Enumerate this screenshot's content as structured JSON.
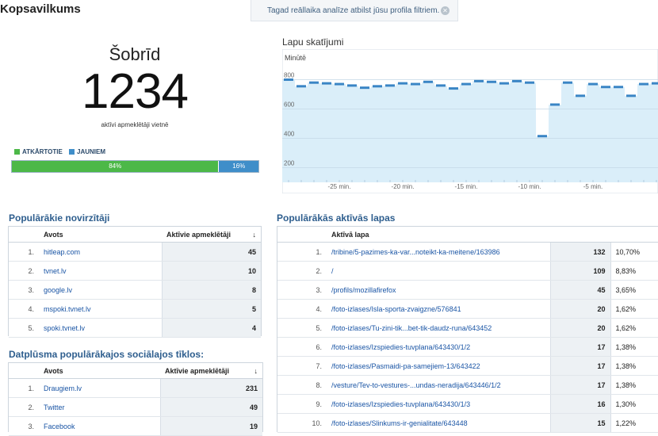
{
  "page_title": "Kopsavilkums",
  "notice": "Tagad reāllaika analīze atbilst jūsu profila filtriem.",
  "now": {
    "label": "Šobrīd",
    "count": "1234",
    "caption": "aktīvi apmeklētāji vietnē"
  },
  "visitor_split": {
    "returning_label": "ATKĀRTOTIE",
    "new_label": "JAUNIEM",
    "returning_pct": "84%",
    "new_pct": "16%",
    "returning_fraction": 0.84,
    "returning_color": "#4cb848",
    "new_color": "#3f8ec9"
  },
  "chart_data": {
    "type": "line",
    "title": "Lapu skatījumi",
    "ylabel": "Minūtē",
    "x_ticks": [
      "-25 min.",
      "-20 min.",
      "-15 min.",
      "-10 min.",
      "-5 min."
    ],
    "y_ticks": [
      "800",
      "600",
      "400",
      "200"
    ],
    "ylim": [
      100,
      900
    ],
    "x_range": [
      -29,
      0
    ],
    "x": [
      -29,
      -28,
      -27,
      -26,
      -25,
      -24,
      -23,
      -22,
      -21,
      -20,
      -19,
      -18,
      -17,
      -16,
      -15,
      -14,
      -13,
      -12,
      -11,
      -10,
      -9,
      -8,
      -7,
      -6,
      -5,
      -4,
      -3,
      -2,
      -1,
      0
    ],
    "values": [
      800,
      755,
      780,
      775,
      770,
      760,
      745,
      755,
      760,
      775,
      770,
      785,
      760,
      740,
      770,
      790,
      785,
      775,
      790,
      780,
      415,
      630,
      780,
      690,
      770,
      750,
      750,
      690,
      770,
      775
    ],
    "line_color": "#3a85c5",
    "fill_color": "#daeef9"
  },
  "referrers": {
    "title": "Populārākie novirzītāji",
    "col_source": "Avots",
    "col_active": "Aktīvie apmeklētāji",
    "sort_icon": "↓",
    "rows": [
      {
        "n": "1.",
        "name": "hitleap.com",
        "value": "45"
      },
      {
        "n": "2.",
        "name": "tvnet.lv",
        "value": "10"
      },
      {
        "n": "3.",
        "name": "google.lv",
        "value": "8"
      },
      {
        "n": "4.",
        "name": "mspoki.tvnet.lv",
        "value": "5"
      },
      {
        "n": "5.",
        "name": "spoki.tvnet.lv",
        "value": "4"
      }
    ]
  },
  "social": {
    "title": "Datplūsma populārākajos sociālajos tīklos:",
    "col_source": "Avots",
    "col_active": "Aktīvie apmeklētāji",
    "sort_icon": "↓",
    "rows": [
      {
        "n": "1.",
        "name": "Draugiem.lv",
        "value": "231"
      },
      {
        "n": "2.",
        "name": "Twitter",
        "value": "49"
      },
      {
        "n": "3.",
        "name": "Facebook",
        "value": "19"
      }
    ]
  },
  "pages": {
    "title": "Populārākās aktīvās lapas",
    "col_page": "Aktīvā lapa",
    "rows": [
      {
        "n": "1.",
        "name": "/tribine/5-pazimes-ka-var...noteikt-ka-meitene/163986",
        "value": "132",
        "pct": "10,70%"
      },
      {
        "n": "2.",
        "name": "/",
        "value": "109",
        "pct": "8,83%"
      },
      {
        "n": "3.",
        "name": "/profils/mozillafirefox",
        "value": "45",
        "pct": "3,65%"
      },
      {
        "n": "4.",
        "name": "/foto-izlases/Isla-sporta-zvaigzne/576841",
        "value": "20",
        "pct": "1,62%"
      },
      {
        "n": "5.",
        "name": "/foto-izlases/Tu-zini-tik...bet-tik-daudz-runa/643452",
        "value": "20",
        "pct": "1,62%"
      },
      {
        "n": "6.",
        "name": "/foto-izlases/Izspiedies-tuvplana/643430/1/2",
        "value": "17",
        "pct": "1,38%"
      },
      {
        "n": "7.",
        "name": "/foto-izlases/Pasmaidi-pa-samejiem-13/643422",
        "value": "17",
        "pct": "1,38%"
      },
      {
        "n": "8.",
        "name": "/vesture/Tev-to-vestures-...undas-neradija/643446/1/2",
        "value": "17",
        "pct": "1,38%"
      },
      {
        "n": "9.",
        "name": "/foto-izlases/Izspiedies-tuvplana/643430/1/3",
        "value": "16",
        "pct": "1,30%"
      },
      {
        "n": "10.",
        "name": "/foto-izlases/Slinkums-ir-genialitate/643448",
        "value": "15",
        "pct": "1,22%"
      }
    ]
  }
}
